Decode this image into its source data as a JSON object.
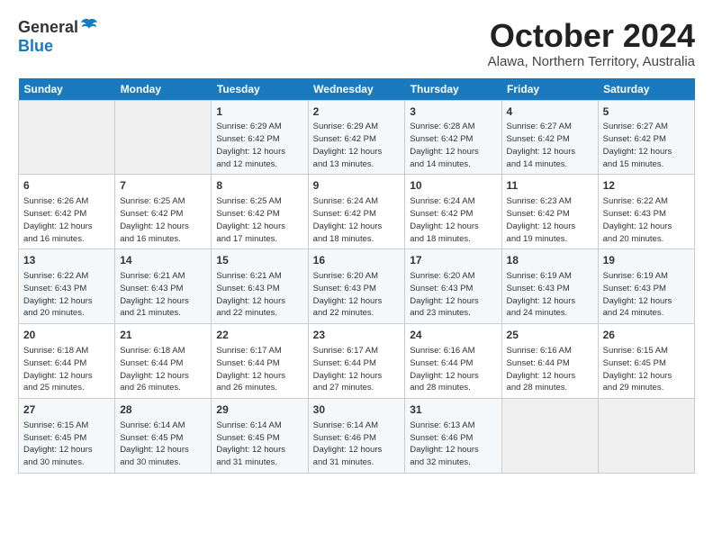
{
  "logo": {
    "general": "General",
    "blue": "Blue"
  },
  "title": "October 2024",
  "location": "Alawa, Northern Territory, Australia",
  "weekdays": [
    "Sunday",
    "Monday",
    "Tuesday",
    "Wednesday",
    "Thursday",
    "Friday",
    "Saturday"
  ],
  "weeks": [
    [
      {
        "day": "",
        "info": ""
      },
      {
        "day": "",
        "info": ""
      },
      {
        "day": "1",
        "info": "Sunrise: 6:29 AM\nSunset: 6:42 PM\nDaylight: 12 hours\nand 12 minutes."
      },
      {
        "day": "2",
        "info": "Sunrise: 6:29 AM\nSunset: 6:42 PM\nDaylight: 12 hours\nand 13 minutes."
      },
      {
        "day": "3",
        "info": "Sunrise: 6:28 AM\nSunset: 6:42 PM\nDaylight: 12 hours\nand 14 minutes."
      },
      {
        "day": "4",
        "info": "Sunrise: 6:27 AM\nSunset: 6:42 PM\nDaylight: 12 hours\nand 14 minutes."
      },
      {
        "day": "5",
        "info": "Sunrise: 6:27 AM\nSunset: 6:42 PM\nDaylight: 12 hours\nand 15 minutes."
      }
    ],
    [
      {
        "day": "6",
        "info": "Sunrise: 6:26 AM\nSunset: 6:42 PM\nDaylight: 12 hours\nand 16 minutes."
      },
      {
        "day": "7",
        "info": "Sunrise: 6:25 AM\nSunset: 6:42 PM\nDaylight: 12 hours\nand 16 minutes."
      },
      {
        "day": "8",
        "info": "Sunrise: 6:25 AM\nSunset: 6:42 PM\nDaylight: 12 hours\nand 17 minutes."
      },
      {
        "day": "9",
        "info": "Sunrise: 6:24 AM\nSunset: 6:42 PM\nDaylight: 12 hours\nand 18 minutes."
      },
      {
        "day": "10",
        "info": "Sunrise: 6:24 AM\nSunset: 6:42 PM\nDaylight: 12 hours\nand 18 minutes."
      },
      {
        "day": "11",
        "info": "Sunrise: 6:23 AM\nSunset: 6:42 PM\nDaylight: 12 hours\nand 19 minutes."
      },
      {
        "day": "12",
        "info": "Sunrise: 6:22 AM\nSunset: 6:43 PM\nDaylight: 12 hours\nand 20 minutes."
      }
    ],
    [
      {
        "day": "13",
        "info": "Sunrise: 6:22 AM\nSunset: 6:43 PM\nDaylight: 12 hours\nand 20 minutes."
      },
      {
        "day": "14",
        "info": "Sunrise: 6:21 AM\nSunset: 6:43 PM\nDaylight: 12 hours\nand 21 minutes."
      },
      {
        "day": "15",
        "info": "Sunrise: 6:21 AM\nSunset: 6:43 PM\nDaylight: 12 hours\nand 22 minutes."
      },
      {
        "day": "16",
        "info": "Sunrise: 6:20 AM\nSunset: 6:43 PM\nDaylight: 12 hours\nand 22 minutes."
      },
      {
        "day": "17",
        "info": "Sunrise: 6:20 AM\nSunset: 6:43 PM\nDaylight: 12 hours\nand 23 minutes."
      },
      {
        "day": "18",
        "info": "Sunrise: 6:19 AM\nSunset: 6:43 PM\nDaylight: 12 hours\nand 24 minutes."
      },
      {
        "day": "19",
        "info": "Sunrise: 6:19 AM\nSunset: 6:43 PM\nDaylight: 12 hours\nand 24 minutes."
      }
    ],
    [
      {
        "day": "20",
        "info": "Sunrise: 6:18 AM\nSunset: 6:44 PM\nDaylight: 12 hours\nand 25 minutes."
      },
      {
        "day": "21",
        "info": "Sunrise: 6:18 AM\nSunset: 6:44 PM\nDaylight: 12 hours\nand 26 minutes."
      },
      {
        "day": "22",
        "info": "Sunrise: 6:17 AM\nSunset: 6:44 PM\nDaylight: 12 hours\nand 26 minutes."
      },
      {
        "day": "23",
        "info": "Sunrise: 6:17 AM\nSunset: 6:44 PM\nDaylight: 12 hours\nand 27 minutes."
      },
      {
        "day": "24",
        "info": "Sunrise: 6:16 AM\nSunset: 6:44 PM\nDaylight: 12 hours\nand 28 minutes."
      },
      {
        "day": "25",
        "info": "Sunrise: 6:16 AM\nSunset: 6:44 PM\nDaylight: 12 hours\nand 28 minutes."
      },
      {
        "day": "26",
        "info": "Sunrise: 6:15 AM\nSunset: 6:45 PM\nDaylight: 12 hours\nand 29 minutes."
      }
    ],
    [
      {
        "day": "27",
        "info": "Sunrise: 6:15 AM\nSunset: 6:45 PM\nDaylight: 12 hours\nand 30 minutes."
      },
      {
        "day": "28",
        "info": "Sunrise: 6:14 AM\nSunset: 6:45 PM\nDaylight: 12 hours\nand 30 minutes."
      },
      {
        "day": "29",
        "info": "Sunrise: 6:14 AM\nSunset: 6:45 PM\nDaylight: 12 hours\nand 31 minutes."
      },
      {
        "day": "30",
        "info": "Sunrise: 6:14 AM\nSunset: 6:46 PM\nDaylight: 12 hours\nand 31 minutes."
      },
      {
        "day": "31",
        "info": "Sunrise: 6:13 AM\nSunset: 6:46 PM\nDaylight: 12 hours\nand 32 minutes."
      },
      {
        "day": "",
        "info": ""
      },
      {
        "day": "",
        "info": ""
      }
    ]
  ]
}
